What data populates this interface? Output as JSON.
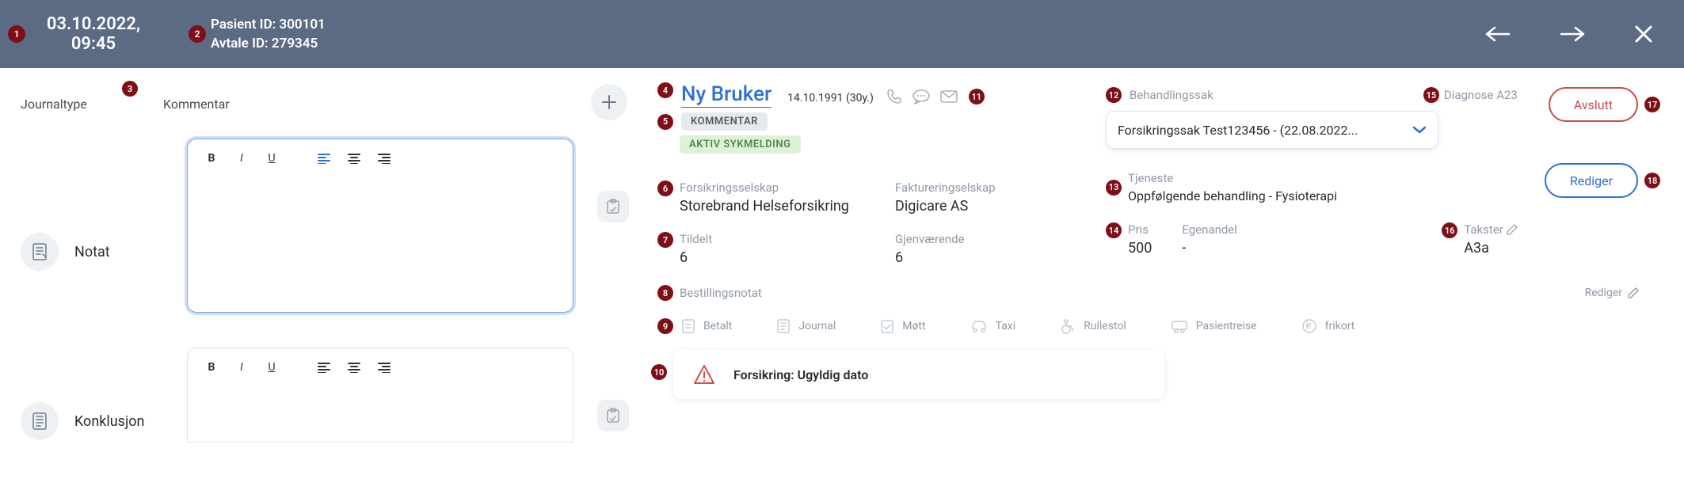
{
  "topbar": {
    "datetime": "03.10.2022, 09:45",
    "patient_id_label": "Pasient ID: 300101",
    "appointment_id_label": "Avtale ID: 279345"
  },
  "badges": {
    "b1": "1",
    "b2": "2",
    "b3": "3",
    "b4": "4",
    "b5": "5",
    "b6": "6",
    "b7": "7",
    "b8": "8",
    "b9": "9",
    "b10": "10",
    "b11": "11",
    "b12": "12",
    "b13": "13",
    "b14": "14",
    "b15": "15",
    "b16": "16",
    "b17": "17",
    "b18": "18"
  },
  "left": {
    "head": {
      "type": "Journaltype",
      "comment": "Kommentar"
    },
    "rows": [
      {
        "label": "Notat"
      },
      {
        "label": "Konklusjon"
      }
    ]
  },
  "patient": {
    "name": "Ny Bruker",
    "birth_age": "14.10.1991 (30y.)",
    "tag_comment": "KOMMENTAR",
    "tag_active_sick": "AKTIV SYKMELDING"
  },
  "case": {
    "label": "Behandlingssak",
    "diagnosis_label": "Diagnose A23",
    "select_text": "Forsikringssak Test123456 - (22.08.2022...",
    "btn_avslutt": "Avslutt",
    "tjeneste_label": "Tjeneste",
    "tjeneste_value": "Oppfølgende behandling - Fysioterapi",
    "btn_rediger": "Rediger",
    "pris_label": "Pris",
    "pris_value": "500",
    "egenandel_label": "Egenandel",
    "egenandel_value": "-",
    "takster_label": "Takster",
    "takster_value": "A3a"
  },
  "insurance": {
    "company_label": "Forsikringsselskap",
    "company_value": "Storebrand Helseforsikring",
    "billing_label": "Faktureringselskap",
    "billing_value": "Digicare AS",
    "assigned_label": "Tildelt",
    "assigned_value": "6",
    "remaining_label": "Gjenværende",
    "remaining_value": "6"
  },
  "order_note": {
    "label": "Bestillingsnotat",
    "rediger_label": "Rediger"
  },
  "flags": {
    "betalt": "Betalt",
    "journal": "Journal",
    "mott": "Møtt",
    "taxi": "Taxi",
    "rullestol": "Rullestol",
    "pasientreise": "Pasientreise",
    "frikort": "frikort"
  },
  "warning": {
    "text": "Forsikring: Ugyldig dato"
  }
}
